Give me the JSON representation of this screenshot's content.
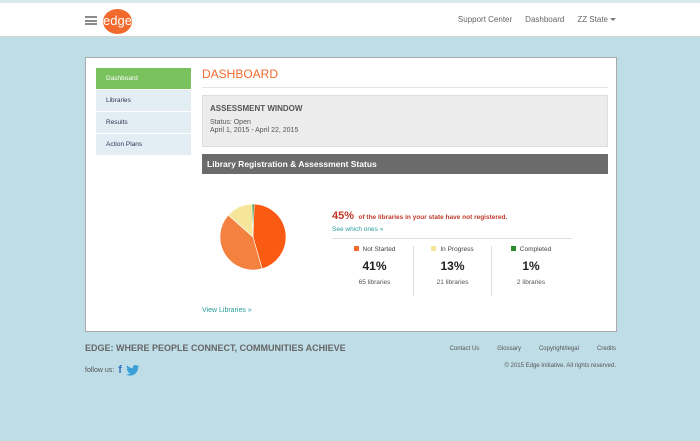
{
  "header": {
    "logo_text": "edge",
    "nav": [
      "Support Center",
      "Dashboard",
      "ZZ State"
    ]
  },
  "sidebar": {
    "items": [
      {
        "label": "Dashboard",
        "active": true
      },
      {
        "label": "Libraries",
        "active": false
      },
      {
        "label": "Results",
        "active": false
      },
      {
        "label": "Action Plans",
        "active": false
      }
    ]
  },
  "main": {
    "title": "DASHBOARD",
    "assessment": {
      "title": "ASSESSMENT WINDOW",
      "status": "Status: Open",
      "dates": "April 1, 2015 - April 22, 2015"
    },
    "registration_title": "Library Registration & Assessment Status",
    "summary_pct": "45%",
    "summary_text": "of the libraries in your state have not registered.",
    "see_link": "See which ones »",
    "stats": [
      {
        "label": "Not Started",
        "value": "41%",
        "sub": "65 libraries",
        "color": "#f46b2e"
      },
      {
        "label": "In Progress",
        "value": "13%",
        "sub": "21 libraries",
        "color": "#f6e49a"
      },
      {
        "label": "Completed",
        "value": "1%",
        "sub": "2 libraries",
        "color": "#2e8b2e"
      }
    ],
    "view_libraries": "View Libraries »"
  },
  "chart_data": {
    "type": "pie",
    "categories": [
      "Not Registered",
      "Not Started",
      "In Progress",
      "Completed"
    ],
    "values": [
      45,
      41,
      13,
      1
    ],
    "colors": [
      "#fb5a12",
      "#f4813f",
      "#f6e69c",
      "#2d8a2d"
    ]
  },
  "footer": {
    "tagline": "EDGE: WHERE PEOPLE CONNECT, COMMUNITIES ACHIEVE",
    "follow": "follow us:",
    "links": [
      "Contact Us",
      "Glossary",
      "Copyright/legal",
      "Credits"
    ],
    "copyright": "© 2015 Edge Initiative. All rights reserved."
  },
  "colors": {
    "accent": "#f26a2e",
    "sidebar_active": "#7ac25d",
    "link": "#2a9d9c"
  }
}
